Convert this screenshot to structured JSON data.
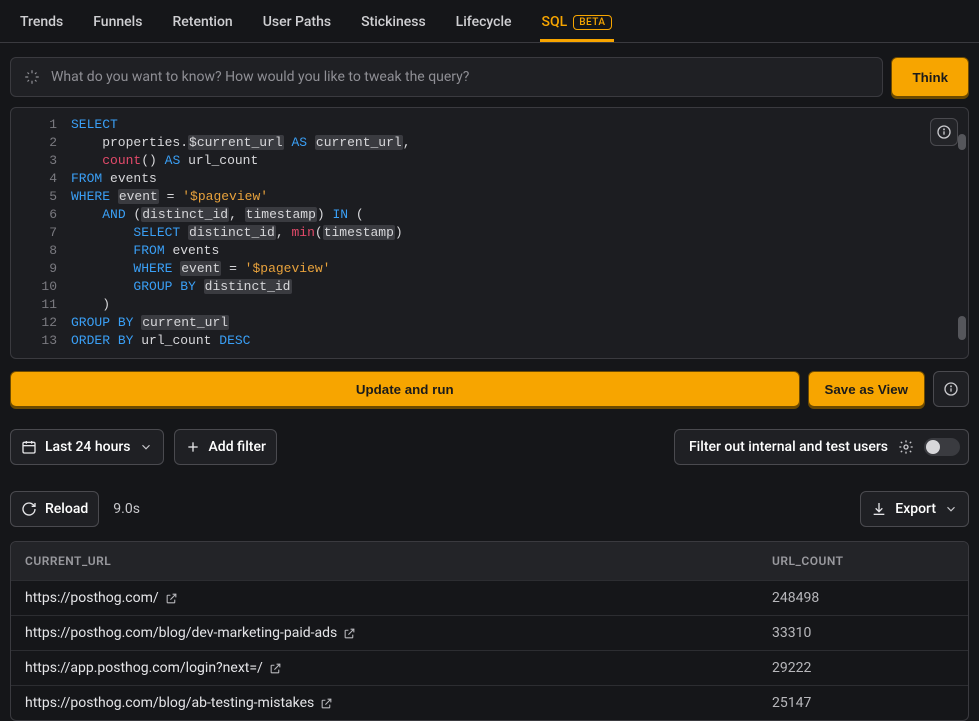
{
  "tabs": [
    "Trends",
    "Funnels",
    "Retention",
    "User Paths",
    "Stickiness",
    "Lifecycle",
    "SQL"
  ],
  "active_tab": "SQL",
  "beta_label": "BETA",
  "query_placeholder": "What do you want to know? How would you like to tweak the query?",
  "think_label": "Think",
  "code_lines": [
    [
      {
        "t": "SELECT",
        "c": "kw"
      }
    ],
    [
      {
        "t": "    properties.",
        "c": "id"
      },
      {
        "t": "$current_url",
        "c": "var"
      },
      {
        "t": " ",
        "c": "id"
      },
      {
        "t": "AS",
        "c": "kw"
      },
      {
        "t": " ",
        "c": "id"
      },
      {
        "t": "current_url",
        "c": "var"
      },
      {
        "t": ",",
        "c": "id"
      }
    ],
    [
      {
        "t": "    ",
        "c": "id"
      },
      {
        "t": "count",
        "c": "fn"
      },
      {
        "t": "()",
        "c": "id"
      },
      {
        "t": " ",
        "c": "id"
      },
      {
        "t": "AS",
        "c": "kw"
      },
      {
        "t": " url_count",
        "c": "id"
      }
    ],
    [
      {
        "t": "FROM",
        "c": "kw"
      },
      {
        "t": " events",
        "c": "id"
      }
    ],
    [
      {
        "t": "WHERE",
        "c": "kw"
      },
      {
        "t": " ",
        "c": "id"
      },
      {
        "t": "event",
        "c": "var"
      },
      {
        "t": " = ",
        "c": "id"
      },
      {
        "t": "'$pageview'",
        "c": "str"
      }
    ],
    [
      {
        "t": "    ",
        "c": "id"
      },
      {
        "t": "AND",
        "c": "kw"
      },
      {
        "t": " (",
        "c": "id"
      },
      {
        "t": "distinct_id",
        "c": "var"
      },
      {
        "t": ", ",
        "c": "id"
      },
      {
        "t": "timestamp",
        "c": "var"
      },
      {
        "t": ") ",
        "c": "id"
      },
      {
        "t": "IN",
        "c": "kw"
      },
      {
        "t": " (",
        "c": "id"
      }
    ],
    [
      {
        "t": "        ",
        "c": "id"
      },
      {
        "t": "SELECT",
        "c": "kw"
      },
      {
        "t": " ",
        "c": "id"
      },
      {
        "t": "distinct_id",
        "c": "var"
      },
      {
        "t": ", ",
        "c": "id"
      },
      {
        "t": "min",
        "c": "fn"
      },
      {
        "t": "(",
        "c": "id"
      },
      {
        "t": "timestamp",
        "c": "var"
      },
      {
        "t": ")",
        "c": "id"
      }
    ],
    [
      {
        "t": "        ",
        "c": "id"
      },
      {
        "t": "FROM",
        "c": "kw"
      },
      {
        "t": " events",
        "c": "id"
      }
    ],
    [
      {
        "t": "        ",
        "c": "id"
      },
      {
        "t": "WHERE",
        "c": "kw"
      },
      {
        "t": " ",
        "c": "id"
      },
      {
        "t": "event",
        "c": "var"
      },
      {
        "t": " = ",
        "c": "id"
      },
      {
        "t": "'$pageview'",
        "c": "str"
      }
    ],
    [
      {
        "t": "        ",
        "c": "id"
      },
      {
        "t": "GROUP",
        "c": "kw"
      },
      {
        "t": " ",
        "c": "id"
      },
      {
        "t": "BY",
        "c": "kw"
      },
      {
        "t": " ",
        "c": "id"
      },
      {
        "t": "distinct_id",
        "c": "var"
      }
    ],
    [
      {
        "t": "    )",
        "c": "id"
      }
    ],
    [
      {
        "t": "GROUP",
        "c": "kw"
      },
      {
        "t": " ",
        "c": "id"
      },
      {
        "t": "BY",
        "c": "kw"
      },
      {
        "t": " ",
        "c": "id"
      },
      {
        "t": "current_url",
        "c": "var"
      }
    ],
    [
      {
        "t": "ORDER",
        "c": "kw"
      },
      {
        "t": " ",
        "c": "id"
      },
      {
        "t": "BY",
        "c": "kw"
      },
      {
        "t": " url_count ",
        "c": "id"
      },
      {
        "t": "DESC",
        "c": "kw"
      }
    ]
  ],
  "update_label": "Update and run",
  "save_view_label": "Save as View",
  "time_filter_label": "Last 24 hours",
  "add_filter_label": "Add filter",
  "filter_internal_label": "Filter out internal and test users",
  "reload_label": "Reload",
  "timing": "9.0s",
  "export_label": "Export",
  "columns": [
    "CURRENT_URL",
    "URL_COUNT"
  ],
  "rows": [
    {
      "url": "https://posthog.com/",
      "count": "248498"
    },
    {
      "url": "https://posthog.com/blog/dev-marketing-paid-ads",
      "count": "33310"
    },
    {
      "url": "https://app.posthog.com/login?next=/",
      "count": "29222"
    },
    {
      "url": "https://posthog.com/blog/ab-testing-mistakes",
      "count": "25147"
    }
  ]
}
